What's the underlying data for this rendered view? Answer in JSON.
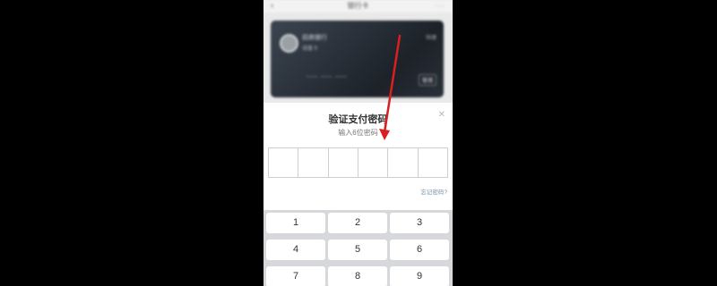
{
  "background_page": {
    "nav_title": "银行卡",
    "card": {
      "bank_name": "招商银行",
      "card_type": "储蓄卡",
      "top_right_text": "快捷",
      "number_mask": "**** **** ****",
      "action_label": "管理"
    }
  },
  "dialog": {
    "title": "验证支付密码",
    "subtitle": "输入6位密码",
    "pin_length": 6,
    "forgot_label": "忘记密码?"
  },
  "keypad": {
    "keys": [
      "1",
      "2",
      "3",
      "4",
      "5",
      "6",
      "7",
      "8",
      "9"
    ]
  },
  "icons": {
    "back": "chevron-left-icon",
    "close": "close-icon",
    "more": "more-icon"
  },
  "colors": {
    "annotation_arrow": "#d91f1f",
    "card": "#1d2229",
    "keypad_bg": "#d7d8db",
    "link": "#7a8fa6"
  }
}
